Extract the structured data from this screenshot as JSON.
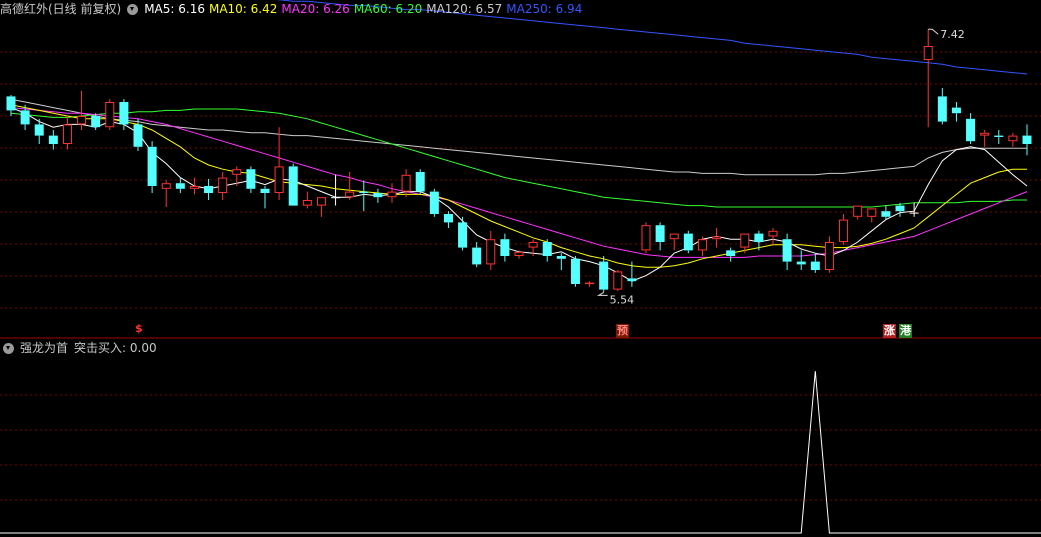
{
  "header": {
    "title": "高德红外(日线 前复权)",
    "ma": [
      {
        "label": "MA5: 6.16",
        "color": "#ffffff"
      },
      {
        "label": "MA10: 6.42",
        "color": "#ffff00"
      },
      {
        "label": "MA20: 6.26",
        "color": "#ff33ff"
      },
      {
        "label": "MA60: 6.20",
        "color": "#33ff33"
      },
      {
        "label": "MA120: 6.57",
        "color": "#cccccc"
      },
      {
        "label": "MA250: 6.94",
        "color": "#3355ff"
      }
    ]
  },
  "sub_header": {
    "title": "强龙为首",
    "value": "突击买入: 0.00"
  },
  "signals": {
    "s_marker": "$",
    "yu": "预",
    "zhang": "涨",
    "gang": "港"
  },
  "colors": {
    "up": "#ff3232",
    "down": "#54ffff",
    "flat": "#ffffff",
    "grid": "#7a0000",
    "divider": "#a00000"
  },
  "chart_data": {
    "type": "candlestick",
    "annotations": {
      "high_label": "7.42",
      "low_label": "5.54"
    },
    "ohlc": [
      [
        6.94,
        6.95,
        6.8,
        6.84
      ],
      [
        6.84,
        6.88,
        6.7,
        6.74
      ],
      [
        6.74,
        6.78,
        6.6,
        6.66
      ],
      [
        6.66,
        6.7,
        6.56,
        6.6
      ],
      [
        6.6,
        6.8,
        6.56,
        6.74
      ],
      [
        6.74,
        6.98,
        6.7,
        6.8
      ],
      [
        6.8,
        6.82,
        6.7,
        6.72
      ],
      [
        6.72,
        6.92,
        6.7,
        6.9
      ],
      [
        6.9,
        6.92,
        6.7,
        6.74
      ],
      [
        6.74,
        6.78,
        6.55,
        6.58
      ],
      [
        6.58,
        6.62,
        6.25,
        6.3
      ],
      [
        6.28,
        6.34,
        6.15,
        6.32
      ],
      [
        6.32,
        6.36,
        6.25,
        6.28
      ],
      [
        6.28,
        6.36,
        6.24,
        6.3
      ],
      [
        6.3,
        6.35,
        6.2,
        6.25
      ],
      [
        6.25,
        6.4,
        6.2,
        6.36
      ],
      [
        6.38,
        6.44,
        6.3,
        6.42
      ],
      [
        6.42,
        6.44,
        6.25,
        6.28
      ],
      [
        6.28,
        6.3,
        6.14,
        6.25
      ],
      [
        6.25,
        6.72,
        6.2,
        6.44
      ],
      [
        6.44,
        6.46,
        6.18,
        6.16
      ],
      [
        6.16,
        6.26,
        6.14,
        6.2
      ],
      [
        6.16,
        6.22,
        6.08,
        6.22
      ],
      [
        6.22,
        6.38,
        6.16,
        6.22
      ],
      [
        6.22,
        6.4,
        6.2,
        6.26
      ],
      [
        6.26,
        6.34,
        6.12,
        6.25
      ],
      [
        6.25,
        6.28,
        6.18,
        6.22
      ],
      [
        6.22,
        6.32,
        6.18,
        6.26
      ],
      [
        6.26,
        6.42,
        6.22,
        6.38
      ],
      [
        6.4,
        6.42,
        6.24,
        6.26
      ],
      [
        6.26,
        6.28,
        6.08,
        6.1
      ],
      [
        6.1,
        6.12,
        6.0,
        6.04
      ],
      [
        6.04,
        6.08,
        5.84,
        5.86
      ],
      [
        5.86,
        5.9,
        5.72,
        5.74
      ],
      [
        5.74,
        5.98,
        5.7,
        5.92
      ],
      [
        5.92,
        5.96,
        5.76,
        5.8
      ],
      [
        5.8,
        5.84,
        5.78,
        5.83
      ],
      [
        5.86,
        5.92,
        5.8,
        5.9
      ],
      [
        5.9,
        5.92,
        5.76,
        5.8
      ],
      [
        5.8,
        5.82,
        5.7,
        5.78
      ],
      [
        5.78,
        5.8,
        5.58,
        5.6
      ],
      [
        5.6,
        5.62,
        5.58,
        5.61
      ],
      [
        5.76,
        5.8,
        5.54,
        5.56
      ],
      [
        5.56,
        5.7,
        5.55,
        5.69
      ],
      [
        5.64,
        5.76,
        5.58,
        5.62
      ],
      [
        5.84,
        6.04,
        5.82,
        6.02
      ],
      [
        6.02,
        6.04,
        5.84,
        5.9
      ],
      [
        5.92,
        5.96,
        5.84,
        5.96
      ],
      [
        5.96,
        5.98,
        5.82,
        5.84
      ],
      [
        5.84,
        5.94,
        5.8,
        5.92
      ],
      [
        5.92,
        6.0,
        5.86,
        5.94
      ],
      [
        5.84,
        5.86,
        5.76,
        5.8
      ],
      [
        5.86,
        5.96,
        5.82,
        5.96
      ],
      [
        5.96,
        5.98,
        5.84,
        5.9
      ],
      [
        5.94,
        6.0,
        5.88,
        5.98
      ],
      [
        5.92,
        5.96,
        5.7,
        5.76
      ],
      [
        5.76,
        5.84,
        5.7,
        5.74
      ],
      [
        5.76,
        5.82,
        5.68,
        5.7
      ],
      [
        5.7,
        5.94,
        5.68,
        5.9
      ],
      [
        5.9,
        6.1,
        5.88,
        6.06
      ],
      [
        6.08,
        6.16,
        6.06,
        6.16
      ],
      [
        6.08,
        6.14,
        6.04,
        6.14
      ],
      [
        6.12,
        6.16,
        6.06,
        6.08
      ],
      [
        6.16,
        6.18,
        6.08,
        6.12
      ],
      [
        6.11,
        6.18,
        6.08,
        6.11
      ],
      [
        7.2,
        7.42,
        6.72,
        7.3
      ],
      [
        6.94,
        7.0,
        6.74,
        6.76
      ],
      [
        6.86,
        6.9,
        6.76,
        6.82
      ],
      [
        6.78,
        6.82,
        6.6,
        6.62
      ],
      [
        6.66,
        6.7,
        6.58,
        6.68
      ],
      [
        6.66,
        6.7,
        6.6,
        6.65
      ],
      [
        6.62,
        6.68,
        6.58,
        6.66
      ],
      [
        6.66,
        6.74,
        6.52,
        6.6
      ]
    ],
    "ma": {
      "MA5": [
        6.86,
        6.82,
        6.76,
        6.72,
        6.74,
        6.74,
        6.72,
        6.76,
        6.74,
        6.68,
        6.54,
        6.46,
        6.36,
        6.3,
        6.28,
        6.3,
        6.32,
        6.34,
        6.31,
        6.35,
        6.34,
        6.3,
        6.26,
        6.22,
        6.22,
        6.24,
        6.23,
        6.24,
        6.26,
        6.26,
        6.22,
        6.15,
        6.05,
        5.95,
        5.9,
        5.86,
        5.83,
        5.82,
        5.81,
        5.83,
        5.78,
        5.76,
        5.73,
        5.68,
        5.62,
        5.66,
        5.72,
        5.82,
        5.86,
        5.92,
        5.94,
        5.92,
        5.92,
        5.9,
        5.92,
        5.9,
        5.85,
        5.82,
        5.8,
        5.84,
        5.9,
        5.98,
        6.06,
        6.11,
        6.12,
        6.31,
        6.48,
        6.56,
        6.58,
        6.56,
        6.47,
        6.38,
        6.3
      ],
      "MA10": [
        6.88,
        6.86,
        6.84,
        6.82,
        6.8,
        6.78,
        6.78,
        6.78,
        6.76,
        6.74,
        6.7,
        6.64,
        6.58,
        6.5,
        6.45,
        6.42,
        6.4,
        6.39,
        6.36,
        6.33,
        6.32,
        6.31,
        6.3,
        6.28,
        6.27,
        6.26,
        6.25,
        6.24,
        6.24,
        6.24,
        6.23,
        6.2,
        6.15,
        6.1,
        6.05,
        6.01,
        5.97,
        5.93,
        5.9,
        5.86,
        5.83,
        5.8,
        5.78,
        5.75,
        5.73,
        5.72,
        5.72,
        5.73,
        5.75,
        5.78,
        5.8,
        5.82,
        5.84,
        5.86,
        5.88,
        5.88,
        5.88,
        5.87,
        5.86,
        5.86,
        5.87,
        5.89,
        5.92,
        5.96,
        6.0,
        6.08,
        6.16,
        6.24,
        6.32,
        6.36,
        6.4,
        6.42,
        6.42
      ],
      "MA20": [
        6.86,
        6.85,
        6.84,
        6.83,
        6.82,
        6.82,
        6.81,
        6.8,
        6.79,
        6.78,
        6.76,
        6.74,
        6.71,
        6.68,
        6.65,
        6.62,
        6.59,
        6.56,
        6.53,
        6.5,
        6.47,
        6.44,
        6.41,
        6.38,
        6.36,
        6.33,
        6.31,
        6.28,
        6.26,
        6.24,
        6.22,
        6.2,
        6.17,
        6.14,
        6.11,
        6.08,
        6.05,
        6.02,
        5.99,
        5.96,
        5.93,
        5.9,
        5.87,
        5.85,
        5.83,
        5.81,
        5.8,
        5.79,
        5.79,
        5.79,
        5.79,
        5.79,
        5.79,
        5.8,
        5.8,
        5.8,
        5.8,
        5.81,
        5.82,
        5.84,
        5.86,
        5.88,
        5.9,
        5.92,
        5.94,
        5.98,
        6.02,
        6.06,
        6.1,
        6.14,
        6.18,
        6.22,
        6.26
      ],
      "MA60": [
        6.82,
        6.81,
        6.8,
        6.79,
        6.79,
        6.8,
        6.81,
        6.82,
        6.82,
        6.83,
        6.83,
        6.84,
        6.84,
        6.85,
        6.85,
        6.85,
        6.85,
        6.84,
        6.83,
        6.82,
        6.8,
        6.78,
        6.75,
        6.72,
        6.69,
        6.66,
        6.63,
        6.6,
        6.57,
        6.54,
        6.51,
        6.48,
        6.45,
        6.42,
        6.39,
        6.36,
        6.34,
        6.32,
        6.3,
        6.28,
        6.26,
        6.24,
        6.22,
        6.21,
        6.2,
        6.19,
        6.18,
        6.17,
        6.16,
        6.16,
        6.15,
        6.15,
        6.15,
        6.15,
        6.15,
        6.15,
        6.15,
        6.15,
        6.15,
        6.15,
        6.15,
        6.15,
        6.16,
        6.17,
        6.18,
        6.18,
        6.18,
        6.18,
        6.19,
        6.19,
        6.19,
        6.2,
        6.2
      ],
      "MA120": [
        6.92,
        6.9,
        6.88,
        6.86,
        6.84,
        6.82,
        6.8,
        6.78,
        6.77,
        6.76,
        6.74,
        6.73,
        6.72,
        6.71,
        6.7,
        6.7,
        6.69,
        6.68,
        6.68,
        6.67,
        6.66,
        6.66,
        6.65,
        6.64,
        6.63,
        6.62,
        6.61,
        6.6,
        6.59,
        6.58,
        6.57,
        6.56,
        6.55,
        6.54,
        6.53,
        6.52,
        6.51,
        6.5,
        6.49,
        6.48,
        6.47,
        6.46,
        6.45,
        6.44,
        6.43,
        6.42,
        6.41,
        6.4,
        6.4,
        6.39,
        6.39,
        6.39,
        6.38,
        6.38,
        6.38,
        6.38,
        6.38,
        6.38,
        6.39,
        6.39,
        6.4,
        6.41,
        6.42,
        6.43,
        6.44,
        6.5,
        6.54,
        6.56,
        6.57,
        6.57,
        6.57,
        6.57,
        6.57
      ],
      "MA250": [
        7.76,
        7.75,
        7.75,
        7.74,
        7.73,
        7.73,
        7.72,
        7.71,
        7.71,
        7.7,
        7.69,
        7.69,
        7.68,
        7.67,
        7.67,
        7.66,
        7.65,
        7.65,
        7.64,
        7.63,
        7.62,
        7.62,
        7.61,
        7.6,
        7.59,
        7.59,
        7.58,
        7.57,
        7.56,
        7.56,
        7.55,
        7.54,
        7.53,
        7.52,
        7.51,
        7.5,
        7.49,
        7.48,
        7.47,
        7.46,
        7.45,
        7.44,
        7.43,
        7.42,
        7.41,
        7.4,
        7.39,
        7.38,
        7.37,
        7.36,
        7.35,
        7.34,
        7.32,
        7.31,
        7.3,
        7.29,
        7.28,
        7.27,
        7.26,
        7.25,
        7.24,
        7.22,
        7.21,
        7.2,
        7.19,
        7.18,
        7.17,
        7.15,
        7.14,
        7.13,
        7.12,
        7.11,
        7.1
      ]
    },
    "price_range": [
      5.4,
      7.5
    ],
    "signal_line": {
      "type": "line",
      "values": [
        0,
        0,
        0,
        0,
        0,
        0,
        0,
        0,
        0,
        0,
        0,
        0,
        0,
        0,
        0,
        0,
        0,
        0,
        0,
        0,
        0,
        0,
        0,
        0,
        0,
        0,
        0,
        0,
        0,
        0,
        0,
        0,
        0,
        0,
        0,
        0,
        0,
        0,
        0,
        0,
        0,
        0,
        0,
        0,
        0,
        0,
        0,
        0,
        0,
        0,
        0,
        0,
        0,
        0,
        0,
        0,
        0,
        1,
        0,
        0,
        0,
        0,
        0,
        0,
        0,
        0,
        0,
        0,
        0,
        0,
        0,
        0,
        0
      ],
      "ylim": [
        0,
        1.1
      ]
    }
  }
}
